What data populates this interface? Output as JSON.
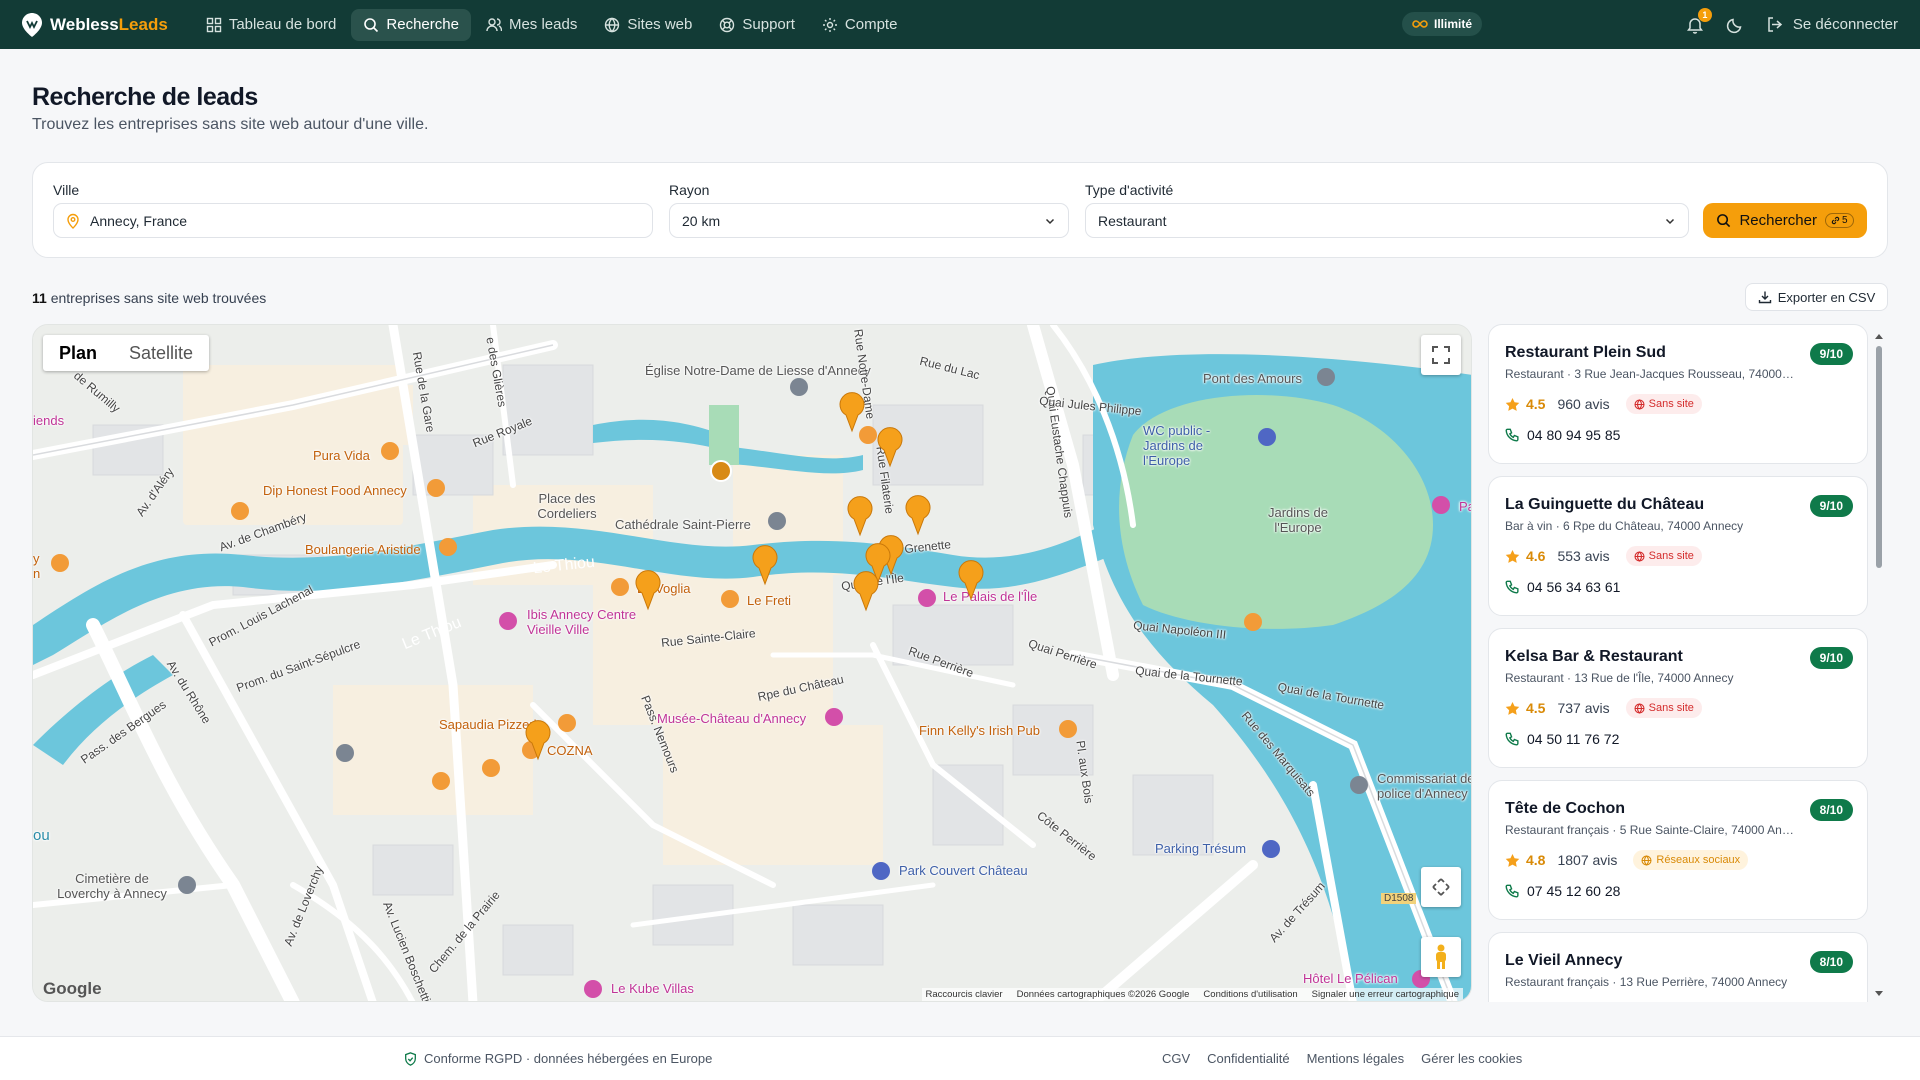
{
  "nav": {
    "brand_a": "Webless",
    "brand_b": "Leads",
    "items": [
      {
        "label": "Tableau de bord",
        "icon": "grid-icon"
      },
      {
        "label": "Recherche",
        "icon": "search-icon",
        "active": true
      },
      {
        "label": "Mes leads",
        "icon": "users-icon"
      },
      {
        "label": "Sites web",
        "icon": "globe-icon"
      },
      {
        "label": "Support",
        "icon": "lifebuoy-icon"
      },
      {
        "label": "Compte",
        "icon": "gear-icon"
      }
    ],
    "plan_badge": "Illimité",
    "notifications": "1",
    "logout": "Se déconnecter"
  },
  "header": {
    "title": "Recherche de leads",
    "subtitle": "Trouvez les entreprises sans site web autour d'une ville."
  },
  "search": {
    "city_label": "Ville",
    "city_value": "Annecy, France",
    "radius_label": "Rayon",
    "radius_value": "20 km",
    "type_label": "Type d'activité",
    "type_value": "Restaurant",
    "button": "Rechercher",
    "credit": "5"
  },
  "results": {
    "count": "11",
    "count_text": "entreprises sans site web trouvées",
    "export": "Exporter en CSV"
  },
  "map": {
    "tab_plan": "Plan",
    "tab_satellite": "Satellite",
    "google": "Google",
    "attribution": [
      "Raccourcis clavier",
      "Données cartographiques ©2026 Google",
      "Conditions d'utilisation",
      "Signaler une erreur cartographique"
    ],
    "labels": {
      "eglise": "Église Notre-Dame de Liesse d'Annecy",
      "pont": "Pont des Amours",
      "wc": "WC public - Jardins de l'Europe",
      "jardins": "Jardins de l'Europe",
      "pura": "Pura Vida",
      "dip": "Dip Honest Food Annecy",
      "boulangerie": "Boulangerie Aristide",
      "place": "Place des Cordeliers",
      "cathedrale": "Cathédrale Saint-Pierre",
      "thiou1": "Le Thiou",
      "thiou2": "Le Thiou",
      "voglia": "La Voglia",
      "freti": "Le Freti",
      "palais": "Le Palais de l'Île",
      "ibis": "Ibis Annecy Centre Vieille Ville",
      "musee": "Musée-Château d'Annecy",
      "finn": "Finn Kelly's Irish Pub",
      "sapaudia": "Sapaudia Pizzeria",
      "cozna": "COZNA",
      "commissariat": "Commissariat de police d'Annecy",
      "parking": "Parking Trésum",
      "park": "Park Couvert Château",
      "cimetiere": "Cimetière de Loverchy à Annecy",
      "kube": "Le Kube Villas",
      "pelican": "Hôtel Le Pélican",
      "friends": "iends",
      "rue_royale": "Rue Royale",
      "rue_rumilly": "de Rumilly",
      "rue_gare": "Rue de la Gare",
      "rue_glieres": "e des Glières",
      "av_chambery": "Av. de Chambéry",
      "av_alery": "Av. d'Aléry",
      "prom_lachenal": "Prom. Louis Lachenal",
      "prom_sepulcre": "Prom. du Saint-Sépulcre",
      "av_rhone": "Av. du Rhône",
      "pass_bergues": "Pass. des Bergues",
      "rue_ste_claire": "Rue Sainte-Claire",
      "rue_chateau": "Rpe du Château",
      "pass_nemours": "Pass. Nemours",
      "quai_ile": "Quai de l'Île",
      "rue_perriere": "Rue Perrière",
      "quai_perriere": "Quai Perrière",
      "quai_tournette": "Quai de la Tournette",
      "quai_tournette2": "Quai de la Tournette",
      "quai_napoleon": "Quai Napoléon III",
      "quai_chappuis": "Quai Eustache Chappuis",
      "quai_jules": "Quai Jules Philippe",
      "rue_lac": "Rue du Lac",
      "rue_filaterie": "Rue Filaterie",
      "rue_nd": "Rue Notre-Dame",
      "rue_marquisats": "Rue des Marquisats",
      "cote_perriere": "Côte Perrière",
      "av_tresum": "Av. de Trésum",
      "av_loverchy": "Av. de Loverchy",
      "chem_prairie": "Chem. de la Prairie",
      "av_boschetti": "Av. Lucien Boschetti",
      "d1508": "D1508",
      "ou": "ou",
      "pa": "Pa",
      "yn": "y n",
      "rue_grenette": "Rue Grenette",
      "rue_pl": "Pl. aux Bois"
    }
  },
  "leads": [
    {
      "name": "Restaurant Plein Sud",
      "address": "Restaurant · 3 Rue Jean-Jacques Rousseau, 74000 Annecy",
      "score": "9/10",
      "rating": "4.5",
      "reviews": "960 avis",
      "tag": "Sans site",
      "tag_type": "red",
      "phone": "04 80 94 95 85"
    },
    {
      "name": "La Guinguette du Château",
      "address": "Bar à vin · 6 Rpe du Château, 74000 Annecy",
      "score": "9/10",
      "rating": "4.6",
      "reviews": "553 avis",
      "tag": "Sans site",
      "tag_type": "red",
      "phone": "04 56 34 63 61"
    },
    {
      "name": "Kelsa Bar & Restaurant",
      "address": "Restaurant · 13 Rue de l'Île, 74000 Annecy",
      "score": "9/10",
      "rating": "4.5",
      "reviews": "737 avis",
      "tag": "Sans site",
      "tag_type": "red",
      "phone": "04 50 11 76 72"
    },
    {
      "name": "Tête de Cochon",
      "address": "Restaurant français · 5 Rue Sainte-Claire, 74000 Annecy",
      "score": "8/10",
      "rating": "4.8",
      "reviews": "1807 avis",
      "tag": "Réseaux sociaux",
      "tag_type": "orange",
      "phone": "07 45 12 60 28"
    },
    {
      "name": "Le Vieil Annecy",
      "address": "Restaurant français · 13 Rue Perrière, 74000 Annecy",
      "score": "8/10",
      "rating": "",
      "reviews": "",
      "tag": "",
      "tag_type": "",
      "phone": ""
    }
  ],
  "footer": {
    "rgpd": "Conforme RGPD · données hébergées en Europe",
    "links": [
      "CGV",
      "Confidentialité",
      "Mentions légales",
      "Gérer les cookies"
    ]
  },
  "colors": {
    "nav": "#123b36",
    "accent": "#f59e0b",
    "score": "#0f7a4a",
    "water": "#6cc6dc",
    "park": "#a8dcb7"
  }
}
